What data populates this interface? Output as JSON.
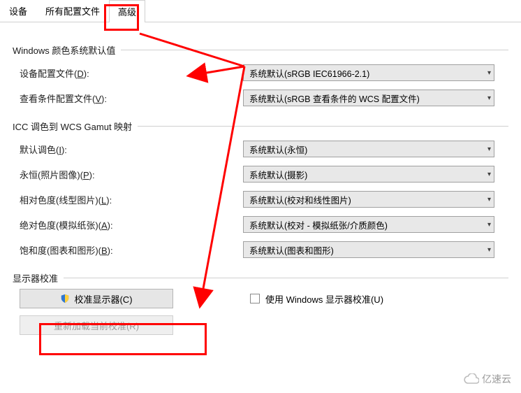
{
  "tabs": {
    "items": [
      {
        "label": "设备"
      },
      {
        "label": "所有配置文件"
      },
      {
        "label": "高级"
      }
    ],
    "active_index": 2
  },
  "section_defaults": {
    "title": "Windows 颜色系统默认值",
    "device_profile": {
      "label_prefix": "设备配置文件(",
      "hotkey": "D",
      "label_suffix": "):",
      "value": "系统默认(sRGB IEC61966-2.1)"
    },
    "viewing_profile": {
      "label_prefix": "查看条件配置文件(",
      "hotkey": "V",
      "label_suffix": "):",
      "value": "系统默认(sRGB 查看条件的 WCS 配置文件)"
    }
  },
  "section_icc": {
    "title": "ICC 调色到 WCS Gamut 映射",
    "default_tone": {
      "label_prefix": "默认调色(",
      "hotkey": "I",
      "label_suffix": "):",
      "value": "系统默认(永恒)"
    },
    "perceptual": {
      "label_prefix": "永恒(照片图像)(",
      "hotkey": "P",
      "label_suffix": "):",
      "value": "系统默认(摄影)"
    },
    "relative": {
      "label_prefix": "相对色度(线型图片)(",
      "hotkey": "L",
      "label_suffix": "):",
      "value": "系统默认(校对和线性图片)"
    },
    "absolute": {
      "label_prefix": "绝对色度(模拟纸张)(",
      "hotkey": "A",
      "label_suffix": "):",
      "value": "系统默认(校对 - 模拟纸张/介质颜色)"
    },
    "saturation": {
      "label_prefix": "饱和度(图表和图形)(",
      "hotkey": "B",
      "label_suffix": "):",
      "value": "系统默认(图表和图形)"
    }
  },
  "section_calibrate": {
    "title": "显示器校准",
    "calibrate_btn": {
      "label_prefix": "校准显示器(",
      "hotkey": "C",
      "label_suffix": ")"
    },
    "reload_btn": {
      "label_prefix": "重新加载当前校准(",
      "hotkey": "R",
      "label_suffix": ")"
    },
    "use_windows": {
      "label_prefix": "使用 Windows 显示器校准(",
      "hotkey": "U",
      "label_suffix": ")",
      "checked": false
    }
  },
  "watermark": "亿速云",
  "annotations": {
    "highlight_tab_index": 2,
    "highlight_calibrate_button": true,
    "arrows": "two red arrows from the highlighted tab toward the device-profile dropdown and toward the calibrate button"
  }
}
